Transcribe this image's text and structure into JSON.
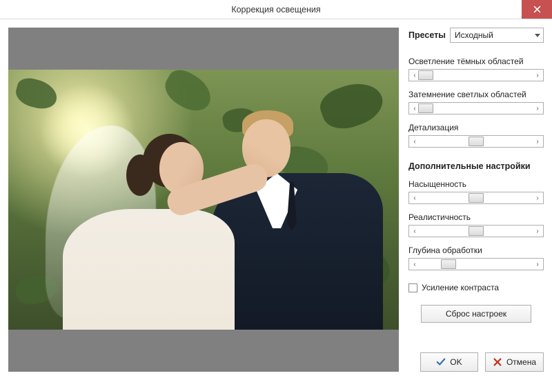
{
  "window": {
    "title": "Коррекция освещения"
  },
  "presets": {
    "label": "Пресеты",
    "selected": "Исходный"
  },
  "sliders": {
    "shadow_lighten": {
      "label": "Осветление тёмных областей",
      "pos": 5
    },
    "highlight_darken": {
      "label": "Затемнение светлых областей",
      "pos": 5
    },
    "detail": {
      "label": "Детализация",
      "pos": 50
    }
  },
  "advanced": {
    "title": "Дополнительные настройки",
    "saturation": {
      "label": "Насыщенность",
      "pos": 50
    },
    "realism": {
      "label": "Реалистичность",
      "pos": 50
    },
    "depth": {
      "label": "Глубина обработки",
      "pos": 25
    }
  },
  "checkbox": {
    "contrast_boost": "Усиление контраста",
    "checked": false
  },
  "buttons": {
    "reset": "Сброс настроек",
    "ok": "OK",
    "cancel": "Отмена"
  }
}
